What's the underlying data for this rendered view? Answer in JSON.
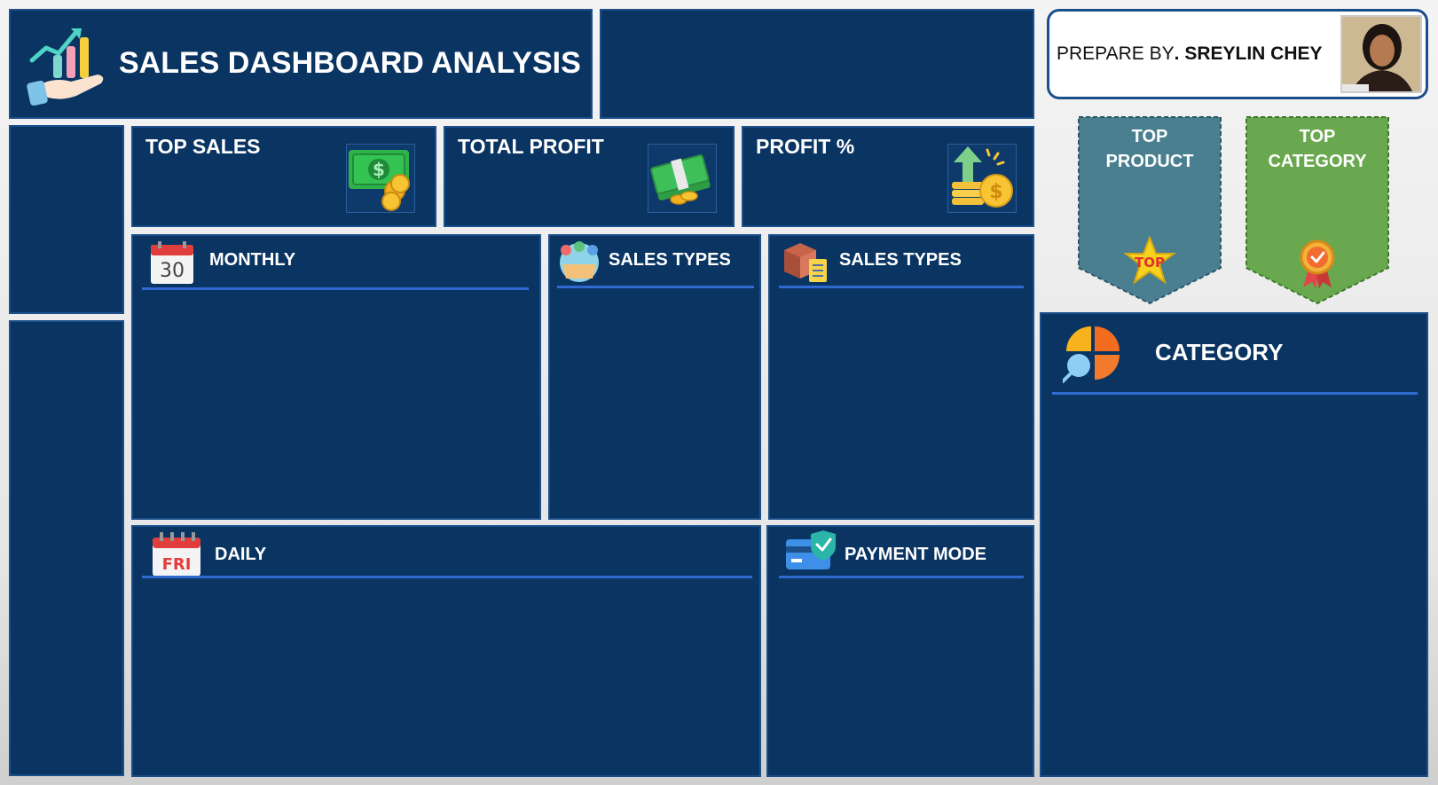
{
  "header": {
    "title": "SALES DASHBOARD ANALYSIS"
  },
  "author": {
    "prefix": "PREPARE BY",
    "name": ". SREYLIN CHEY"
  },
  "kpis": [
    {
      "label": "TOP SALES"
    },
    {
      "label": "TOTAL PROFIT"
    },
    {
      "label": "PROFIT %"
    }
  ],
  "sections": {
    "monthly": {
      "title": "MONTHLY",
      "calendar_day": "30"
    },
    "sales_types_1": {
      "title": "SALES TYPES"
    },
    "sales_types_2": {
      "title": "SALES TYPES"
    },
    "daily": {
      "title": "DAILY",
      "calendar_day": "FRI"
    },
    "payment_mode": {
      "title": "PAYMENT MODE"
    },
    "category": {
      "title": "CATEGORY"
    }
  },
  "ribbons": {
    "top_product": {
      "line1": "TOP",
      "line2": "PRODUCT",
      "badge": "TOP",
      "color": "#4a7f8f"
    },
    "top_category": {
      "line1": "TOP",
      "line2": "CATEGORY",
      "color": "#6aa84f"
    }
  },
  "colors": {
    "panel": "#0a3462",
    "accent_line": "#2f6ad0"
  }
}
